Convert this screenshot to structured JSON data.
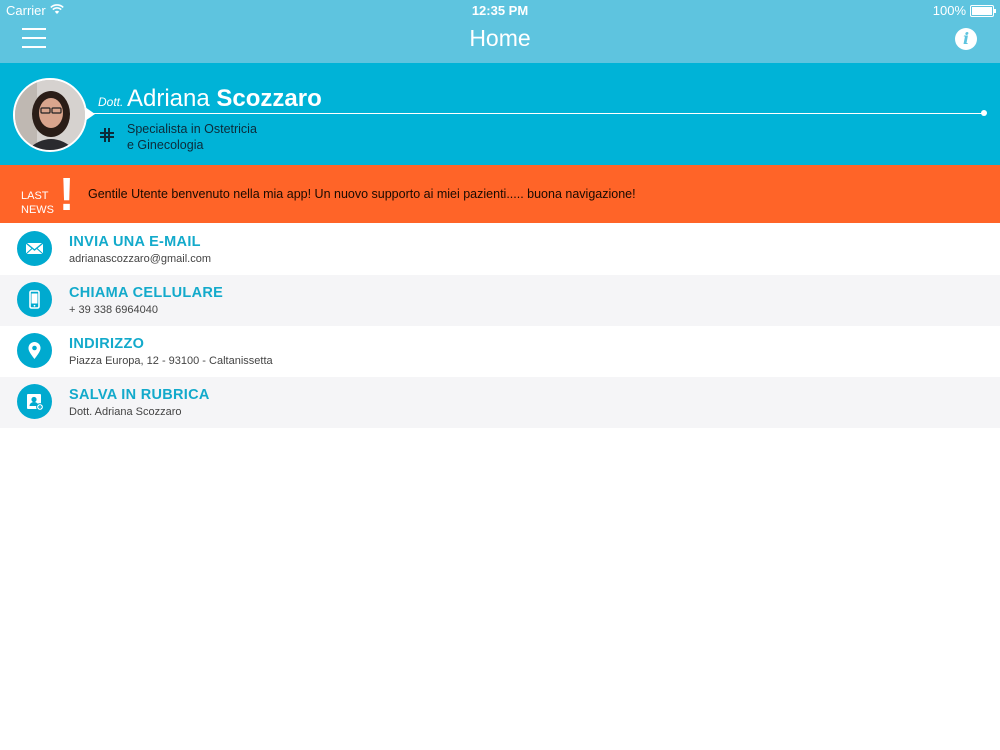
{
  "status_bar": {
    "carrier": "Carrier",
    "time": "12:35 PM",
    "battery": "100%"
  },
  "nav": {
    "title": "Home",
    "menu_icon": "hamburger-icon",
    "info_icon": "info-icon"
  },
  "profile": {
    "prefix": "Dott.",
    "first_name": "Adriana",
    "last_name": "Scozzaro",
    "specialty_line1": "Specialista in Ostetricia",
    "specialty_line2": "e Ginecologia"
  },
  "news": {
    "label_line1": "LAST",
    "label_line2": "NEWS",
    "exclamation": "!",
    "text": "Gentile Utente benvenuto nella mia app! Un nuovo supporto ai miei pazienti..... buona navigazione!"
  },
  "actions": [
    {
      "title": "INVIA UNA E-MAIL",
      "subtitle": "adrianascozzaro@gmail.com",
      "icon": "envelope-icon"
    },
    {
      "title": "CHIAMA CELLULARE",
      "subtitle": "+ 39 338 6964040",
      "icon": "mobile-phone-icon"
    },
    {
      "title": "INDIRIZZO",
      "subtitle": "Piazza Europa, 12 - 93100 - Caltanissetta",
      "icon": "map-pin-icon"
    },
    {
      "title": "SALVA IN RUBRICA",
      "subtitle": "Dott. Adriana Scozzaro",
      "icon": "add-contact-icon"
    }
  ],
  "colors": {
    "nav_bg": "#5ec4df",
    "profile_bg": "#00b3d7",
    "news_bg": "#ff6428",
    "accent": "#13aacb"
  }
}
